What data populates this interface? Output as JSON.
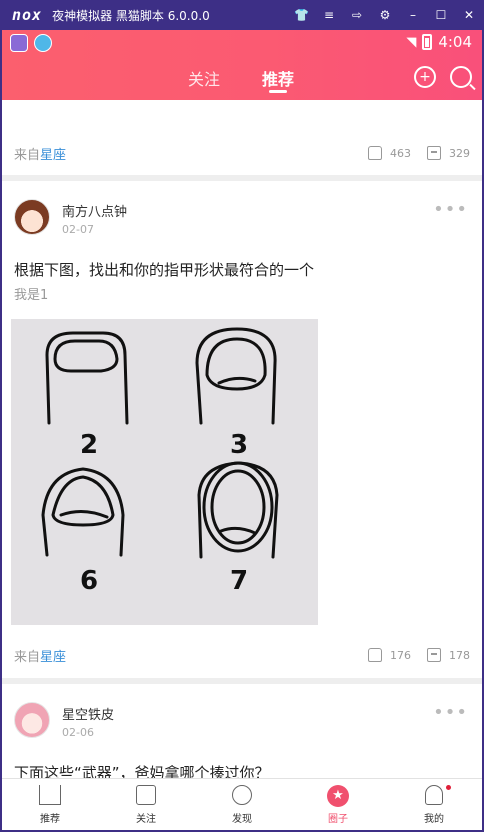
{
  "emulator": {
    "logo": "nox",
    "title": "夜神模拟器 黑猫脚本 6.0.0.0",
    "controls": [
      "tshirt-icon",
      "menu-icon",
      "pin-icon",
      "gear-icon",
      "minimize-icon",
      "maximize-icon",
      "close-icon"
    ]
  },
  "status": {
    "time": "4:04"
  },
  "header": {
    "tabs": [
      {
        "label": "关注",
        "active": false
      },
      {
        "label": "推荐",
        "active": true
      }
    ],
    "accent": "#fb5a72"
  },
  "feed": {
    "posts": [
      {
        "source_prefix": "来自",
        "source_topic": "星座",
        "likes": "463",
        "comments": "329"
      },
      {
        "username": "南方八点钟",
        "date": "02-07",
        "title": "根据下图，找出和你的指甲形状最符合的一个",
        "subtitle": "我是1",
        "image_labels": [
          "2",
          "3",
          "6",
          "7"
        ],
        "source_prefix": "来自",
        "source_topic": "星座",
        "likes": "176",
        "comments": "178"
      },
      {
        "username": "星空铁皮",
        "date": "02-06",
        "title": "下面这些“武器”，爸妈拿哪个揍过你？"
      }
    ]
  },
  "bottom_nav": {
    "items": [
      {
        "label": "推荐",
        "icon": "home-icon",
        "active": false
      },
      {
        "label": "关注",
        "icon": "follow-icon",
        "active": false
      },
      {
        "label": "发现",
        "icon": "discover-icon",
        "active": false
      },
      {
        "label": "圈子",
        "icon": "circle-star-icon",
        "active": true
      },
      {
        "label": "我的",
        "icon": "profile-icon",
        "active": false
      }
    ],
    "active_color": "#f0506e"
  }
}
